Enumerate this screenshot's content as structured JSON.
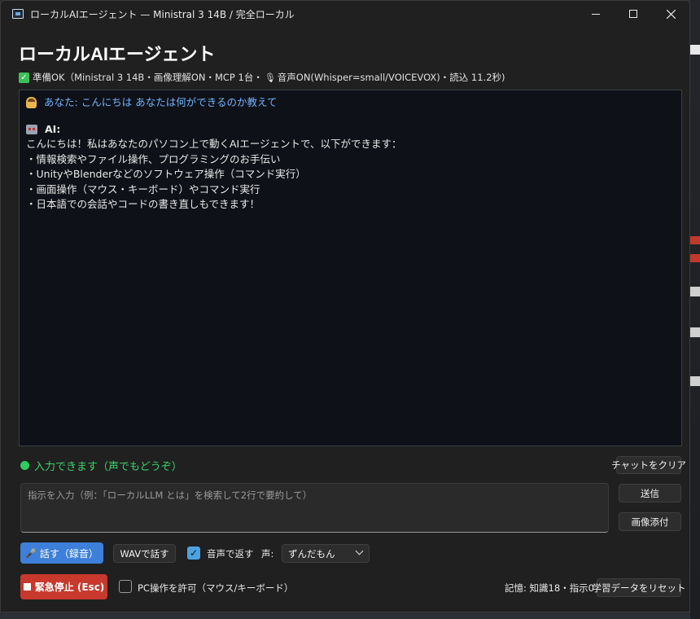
{
  "window": {
    "title": "ローカルAIエージェント — Ministral 3 14B / 完全ローカル",
    "minimize_label": "—",
    "maximize_label": "☐",
    "close_label": "✕"
  },
  "header": {
    "title": "ローカルAIエージェント",
    "status": "準備OK（Ministral 3 14B・画像理解ON・MCP 1台・",
    "status_tail": "音声ON(Whisper=small/VOICEVOX)・読込 11.2秒)"
  },
  "chat": {
    "user_prefix": "あなた:",
    "user_message": "こんにちは あなたは何ができるのか教えて",
    "ai_prefix": "AI:",
    "ai_lines": [
      "こんにちは！私はあなたのパソコン上で動くAIエージェントで、以下ができます：",
      "・情報検索やファイル操作、プログラミングのお手伝い",
      "・UnityやBlenderなどのソフトウェア操作（コマンド実行）",
      "・画面操作（マウス・キーボード）やコマンド実行",
      "・日本語での会話やコードの書き直しもできます！"
    ]
  },
  "status_bar": {
    "ready_text": "入力できます（声でもどうぞ）",
    "clear_button": "チャットをクリア"
  },
  "input": {
    "placeholder": "指示を入力（例：「ローカルLLM とは」を検索して2行で要約して）",
    "send_button": "送信",
    "attach_button": "画像添付"
  },
  "voice": {
    "talk_button": "話す（録音）",
    "wav_button": "WAVで話す",
    "reply_voice_label": "音声で返す",
    "reply_voice_checked": true,
    "voice_label": "声:",
    "voice_selected": "ずんだもん"
  },
  "footer": {
    "emergency_button": "緊急停止 (Esc)",
    "pc_control_label": "PC操作を許可（マウス/キーボード）",
    "pc_control_checked": false,
    "memory_text": "記憶: 知識18・指示0",
    "reset_button": "学習データをリセット"
  },
  "colors": {
    "accent_blue": "#3d7fd9",
    "danger_red": "#c8382d",
    "ready_green": "#3bd46a",
    "user_text_blue": "#6fb4ff"
  }
}
